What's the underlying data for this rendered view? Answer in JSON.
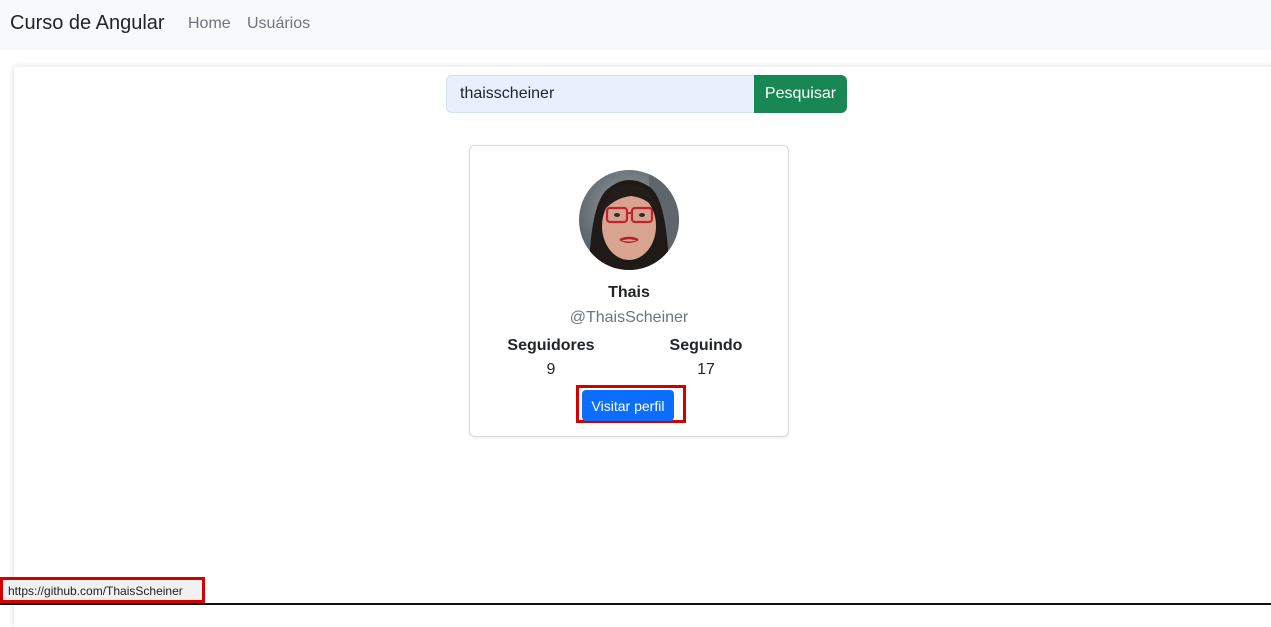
{
  "navbar": {
    "brand": "Curso de Angular",
    "links": [
      "Home",
      "Usuários"
    ]
  },
  "search": {
    "value": "thaisscheiner",
    "button_label": "Pesquisar"
  },
  "profile": {
    "name": "Thais",
    "handle": "@ThaisScheiner",
    "stats": [
      {
        "label": "Seguidores",
        "value": "9"
      },
      {
        "label": "Seguindo",
        "value": "17"
      }
    ],
    "visit_label": "Visitar perfil"
  },
  "status_bar": {
    "url": "https://github.com/ThaisScheiner"
  },
  "colors": {
    "navbar_bg": "#f8f9fa",
    "search_button": "#198754",
    "visit_button": "#0d6efd",
    "highlight": "#d40000"
  }
}
